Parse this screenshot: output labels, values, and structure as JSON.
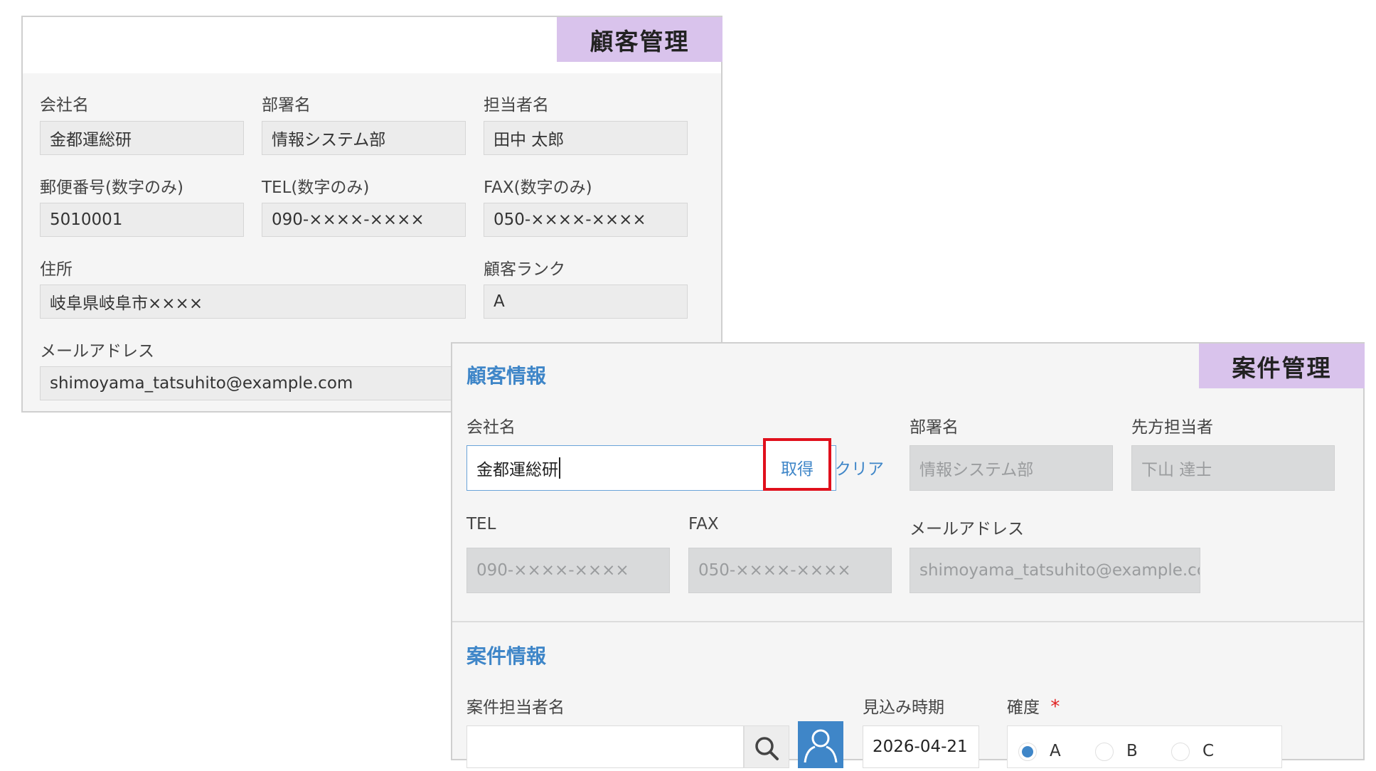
{
  "customer_panel": {
    "title": "顧客管理",
    "fields": {
      "company_label": "会社名",
      "company_value": "金都運総研",
      "dept_label": "部署名",
      "dept_value": "情報システム部",
      "person_label": "担当者名",
      "person_value": "田中 太郎",
      "zip_label": "郵便番号(数字のみ)",
      "zip_value": "5010001",
      "tel_label": "TEL(数字のみ)",
      "tel_value": "090-××××-××××",
      "fax_label": "FAX(数字のみ)",
      "fax_value": "050-××××-××××",
      "address_label": "住所",
      "address_value": "岐阜県岐阜市××××",
      "rank_label": "顧客ランク",
      "rank_value": "A",
      "email_label": "メールアドレス",
      "email_value": "shimoyama_tatsuhito@example.com"
    }
  },
  "project_panel": {
    "title": "案件管理",
    "customer_section": {
      "heading": "顧客情報",
      "company_label": "会社名",
      "company_value": "金都運総研",
      "fetch_label": "取得",
      "clear_label": "クリア",
      "dept_label": "部署名",
      "dept_value": "情報システム部",
      "contact_label": "先方担当者",
      "contact_value": "下山 達士",
      "tel_label": "TEL",
      "tel_value": "090-××××-××××",
      "fax_label": "FAX",
      "fax_value": "050-××××-××××",
      "email_label": "メールアドレス",
      "email_value": "shimoyama_tatsuhito@example.cc"
    },
    "project_section": {
      "heading": "案件情報",
      "owner_label": "案件担当者名",
      "owner_value": "",
      "forecast_label": "見込み時期",
      "forecast_value": "2026-04-21",
      "certainty_label": "確度",
      "required_mark": "*",
      "certainty_options": [
        "A",
        "B",
        "C"
      ],
      "certainty_selected": "A"
    }
  },
  "colors": {
    "accent": "#3f86c8",
    "title_tag": "#d9c3ec",
    "highlight": "#e0101c",
    "required": "#e02020"
  }
}
